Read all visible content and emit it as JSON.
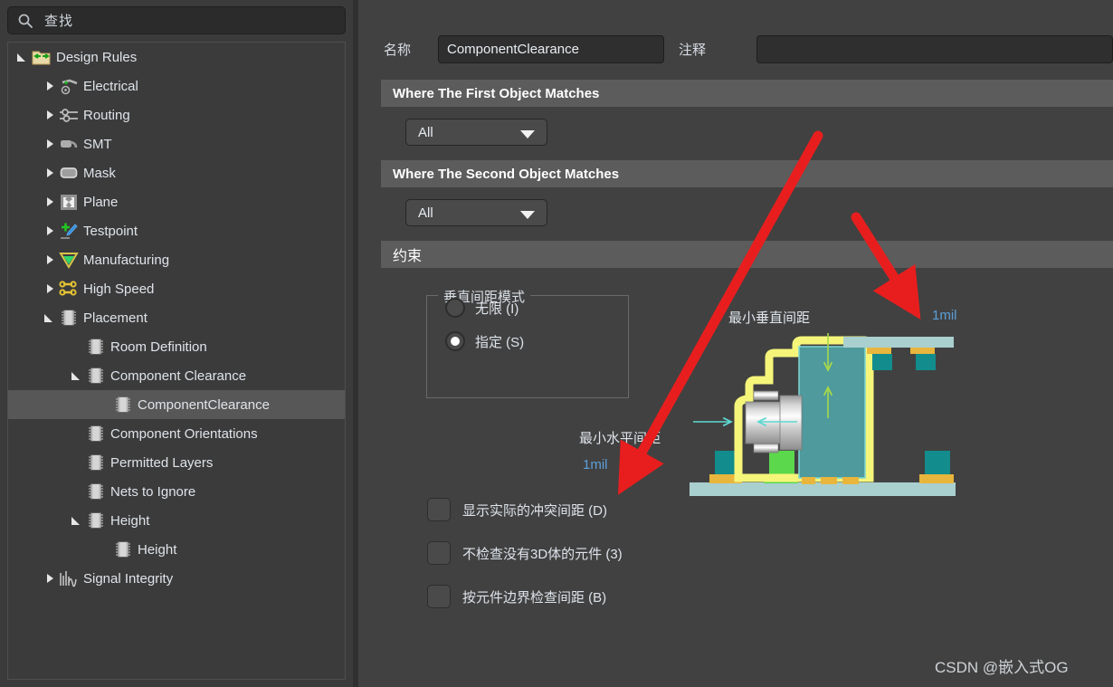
{
  "search": {
    "placeholder": "查找",
    "value": "",
    "icon": "search-icon"
  },
  "tree": {
    "items": [
      {
        "label": "Design Rules",
        "indent": 0,
        "twist": "open",
        "icon": "folder-rules-icon",
        "selected": false
      },
      {
        "label": "Electrical",
        "indent": 1,
        "twist": "closed",
        "icon": "electrical-icon",
        "selected": false
      },
      {
        "label": "Routing",
        "indent": 1,
        "twist": "closed",
        "icon": "routing-icon",
        "selected": false
      },
      {
        "label": "SMT",
        "indent": 1,
        "twist": "closed",
        "icon": "smt-icon",
        "selected": false
      },
      {
        "label": "Mask",
        "indent": 1,
        "twist": "closed",
        "icon": "mask-icon",
        "selected": false
      },
      {
        "label": "Plane",
        "indent": 1,
        "twist": "closed",
        "icon": "plane-icon",
        "selected": false
      },
      {
        "label": "Testpoint",
        "indent": 1,
        "twist": "closed",
        "icon": "testpoint-icon",
        "selected": false
      },
      {
        "label": "Manufacturing",
        "indent": 1,
        "twist": "closed",
        "icon": "manufacturing-icon",
        "selected": false
      },
      {
        "label": "High Speed",
        "indent": 1,
        "twist": "closed",
        "icon": "high-speed-icon",
        "selected": false
      },
      {
        "label": "Placement",
        "indent": 1,
        "twist": "open",
        "icon": "placement-icon",
        "selected": false
      },
      {
        "label": "Room Definition",
        "indent": 2,
        "twist": "none",
        "icon": "placement-icon",
        "selected": false
      },
      {
        "label": "Component Clearance",
        "indent": 2,
        "twist": "open",
        "icon": "placement-icon",
        "selected": false
      },
      {
        "label": "ComponentClearance",
        "indent": 3,
        "twist": "none",
        "icon": "placement-icon",
        "selected": true
      },
      {
        "label": "Component Orientations",
        "indent": 2,
        "twist": "none",
        "icon": "placement-icon",
        "selected": false
      },
      {
        "label": "Permitted Layers",
        "indent": 2,
        "twist": "none",
        "icon": "placement-icon",
        "selected": false
      },
      {
        "label": "Nets to Ignore",
        "indent": 2,
        "twist": "none",
        "icon": "placement-icon",
        "selected": false
      },
      {
        "label": "Height",
        "indent": 2,
        "twist": "open",
        "icon": "placement-icon",
        "selected": false
      },
      {
        "label": "Height",
        "indent": 3,
        "twist": "none",
        "icon": "placement-icon",
        "selected": false
      },
      {
        "label": "Signal Integrity",
        "indent": 1,
        "twist": "closed",
        "icon": "signal-integrity-icon",
        "selected": false
      }
    ]
  },
  "form": {
    "name_label": "名称",
    "name_value": "ComponentClearance",
    "name_placeholder": "",
    "comment_label": "注释",
    "comment_value": "",
    "comment_placeholder": ""
  },
  "sections": {
    "first_object": {
      "title": "Where The First Object Matches",
      "dropdown_value": "All"
    },
    "second_object": {
      "title": "Where The Second Object Matches",
      "dropdown_value": "All"
    },
    "constraints": {
      "title": "约束"
    }
  },
  "vertical_mode": {
    "legend": "垂直间距模式",
    "options": [
      {
        "label": "无限 (I)",
        "selected": false
      },
      {
        "label": "指定 (S)",
        "selected": true
      }
    ]
  },
  "checkboxes": [
    {
      "label": "显示实际的冲突间距 (D)",
      "checked": false
    },
    {
      "label": "不检查没有3D体的元件 (3)",
      "checked": false
    },
    {
      "label": "按元件边界检查间距 (B)",
      "checked": false
    }
  ],
  "diagram": {
    "vertical_label": "最小垂直间距",
    "vertical_value": "1mil",
    "horizontal_label": "最小水平间距",
    "horizontal_value": "1mil",
    "annotation_color": "#e81e1e",
    "value_color": "#5b9fd8"
  },
  "watermark": {
    "text": "CSDN @嵌入式OG"
  }
}
